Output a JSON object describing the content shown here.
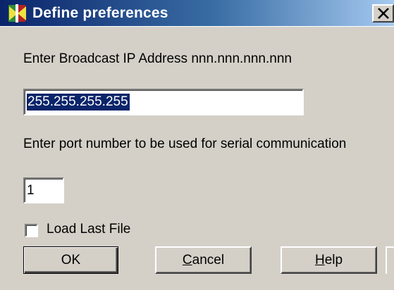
{
  "window": {
    "title": "Define preferences",
    "title_icon": "app-icon",
    "close_icon": "close-icon",
    "titlebar_color_start": "#0a246a",
    "titlebar_color_end": "#a6caf0",
    "background_color": "#d4d0c8"
  },
  "ip_section": {
    "label": "Enter Broadcast IP Address nnn.nnn.nnn.nnn",
    "value": "255.255.255.255",
    "selected": true,
    "selection_color": "#0a246a"
  },
  "port_section": {
    "label": "Enter port number to be used for serial communication",
    "value": "1"
  },
  "load_last_file": {
    "label": "Load Last File",
    "checked": false
  },
  "buttons": {
    "ok": {
      "label": "OK",
      "default": true
    },
    "cancel": {
      "label_access_key": "C",
      "label_rest": "ancel"
    },
    "help": {
      "label_access_key": "H",
      "label_rest": "elp"
    }
  }
}
